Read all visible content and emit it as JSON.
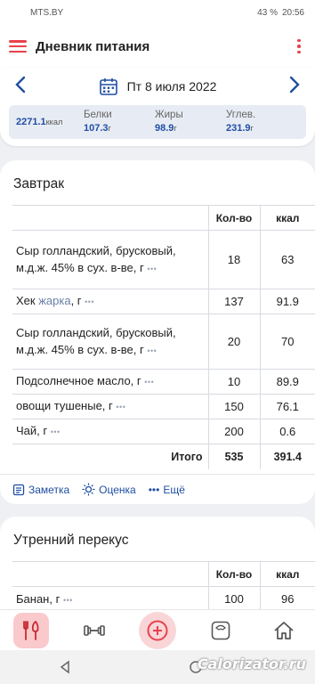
{
  "status": {
    "carrier": "MTS.BY",
    "battery": "43 %",
    "time": "20:56"
  },
  "app": {
    "title": "Дневник питания"
  },
  "date": {
    "label": "Пт 8 июля 2022"
  },
  "totals": {
    "kcal_value": "2271.1",
    "kcal_unit": "ккал",
    "protein_label": "Белки",
    "protein_value": "107.3",
    "protein_unit": "г",
    "fat_label": "Жиры",
    "fat_value": "98.9",
    "fat_unit": "г",
    "carbs_label": "Углев.",
    "carbs_value": "231.9",
    "carbs_unit": "г"
  },
  "breakfast": {
    "title": "Завтрак",
    "col_qty": "Кол-во",
    "col_kcal": "ккал",
    "items": [
      {
        "name": "Сыр голландский, брусковый, м.д.ж. 45% в сух. в-ве, г",
        "qty": "18",
        "kcal": "63"
      },
      {
        "name_pre": "Хек ",
        "name_link": "жарка",
        "name_post": ", г",
        "qty": "137",
        "kcal": "91.9"
      },
      {
        "name": "Сыр голландский, брусковый, м.д.ж. 45% в сух. в-ве, г",
        "qty": "20",
        "kcal": "70"
      },
      {
        "name": "Подсолнечное масло, г",
        "qty": "10",
        "kcal": "89.9"
      },
      {
        "name": "овощи тушеные, г",
        "qty": "150",
        "kcal": "76.1"
      },
      {
        "name": "Чай, г",
        "qty": "200",
        "kcal": "0.6"
      }
    ],
    "total_label": "Итого",
    "total_qty": "535",
    "total_kcal": "391.4",
    "actions": {
      "note": "Заметка",
      "rating": "Оценка",
      "more": "Ещё"
    }
  },
  "snack": {
    "title": "Утренний перекус",
    "col_qty": "Кол-во",
    "col_kcal": "ккал",
    "items": [
      {
        "name": "Банан, г",
        "qty": "100",
        "kcal": "96"
      }
    ]
  },
  "more_dots": "•••",
  "watermark": "Calorizator.ru",
  "colors": {
    "accent": "#e8424c",
    "primary": "#1f4ea3",
    "background": "#eef0f4"
  },
  "icons": [
    "menu-icon",
    "more-vert-icon",
    "chevron-left-icon",
    "calendar-icon",
    "chevron-right-icon",
    "note-icon",
    "rating-icon",
    "ellipsis-icon",
    "diary-icon",
    "dumbbell-icon",
    "add-circle-icon",
    "scale-icon",
    "home-icon",
    "back-nav-icon",
    "home-nav-icon"
  ]
}
